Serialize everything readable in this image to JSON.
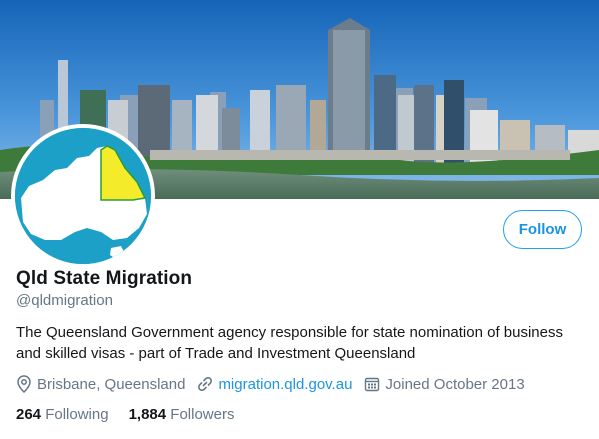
{
  "profile": {
    "display_name": "Qld State Migration",
    "handle": "@qldmigration",
    "bio": "The Queensland Government agency responsible for state nomination of business and skilled visas - part of Trade and Investment Queensland",
    "location": "Brisbane, Queensland",
    "website": "migration.qld.gov.au",
    "joined": "Joined October 2013"
  },
  "actions": {
    "follow_label": "Follow"
  },
  "stats": {
    "following_count": "264",
    "following_label": "Following",
    "followers_count": "1,884",
    "followers_label": "Followers"
  },
  "icons": {
    "location": "location-pin-icon",
    "link": "link-icon",
    "calendar": "calendar-icon"
  },
  "colors": {
    "accent": "#1da1f2",
    "avatar_bg": "#1da0c7",
    "queensland_highlight": "#f4ec2a"
  }
}
